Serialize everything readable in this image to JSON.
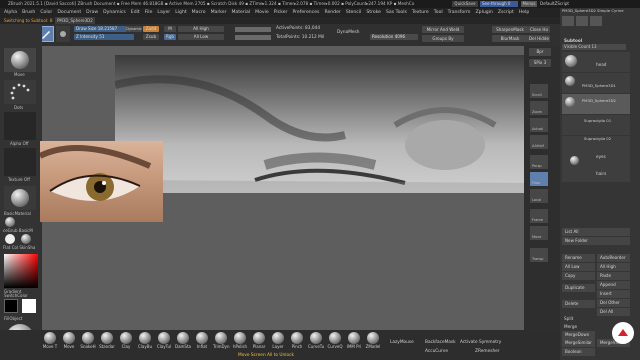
{
  "titlebar": {
    "text": "ZBrush 2021.5.1  [David Saccoti]   ZBrush Document   ▪ Free Mem 46.818GB ▪ Active Mem 2705 ▪ Scratch Disk 49 ▪ ZTime▸1.324 ▪ Timer▸2.078 ▪ Timer▸0.002 ▪ PolyCount▸247.194 KP ▪ MeshCo",
    "quicksave": "QuickSave",
    "seethrough": "See-through  0",
    "menus": "Menus",
    "script": "DefaultZScript"
  },
  "menubar": {
    "items": [
      "Alpha",
      "Brush",
      "Color",
      "Document",
      "Draw",
      "Dynamics",
      "Edit",
      "File",
      "Layer",
      "Light",
      "Macro",
      "Marker",
      "Material",
      "Movie",
      "Picker",
      "Preferences",
      "Render",
      "Stencil",
      "Stroke",
      "Sas Tools",
      "Texture",
      "Tool",
      "Transform",
      "Zplugin",
      "Zscript",
      "Help"
    ]
  },
  "subbar": {
    "text": "Switching to Subtool: 8",
    "tool": "PM3D_Sphere3D2"
  },
  "toolbar": {
    "mirror": "Mirror",
    "multimapper": "MultiMap",
    "draw_size": "Draw Size 18.21587",
    "z_intensity": "Z Intensity 51",
    "dynamic": "Dynamic",
    "zadd": "Zadd",
    "zsub": "Zsub",
    "zcut": "Zcut",
    "mrgb": "Rgb",
    "m": "M",
    "rgb_label": "Rgb",
    "all_high": "All High",
    "all_low": "All Low",
    "active_points": "ActivePoints: 83,044",
    "total_points": "TotalPoints: 10.212 Mil",
    "dynamesh": "DynaMesh",
    "resolution": "Resolution 4096",
    "mirror_weld": "Mirror And Weld",
    "group_by": "Groups By",
    "sharpen_mask": "SharpenMask",
    "blur_mask": "BlurMask",
    "close_holes": "Close Ho",
    "del_hidden": "Del Hidde"
  },
  "leftpanel": {
    "move": "Move",
    "dots": "Dots",
    "alpha_off": "Alpha Off",
    "texture_off": "Texture Off",
    "basic_material": "BasicMaterial",
    "zbrush_basic": "ceGrub BasicM",
    "flat_color": "Flat Col SkinSha",
    "gradient": "Gradient",
    "switch_color": "SwitchColor",
    "fill_object": "FillObject"
  },
  "rightstrip": {
    "items": [
      "Bpr",
      "SPix 3",
      "Scroll",
      "Zoom",
      "Actual",
      "AAHalf",
      "Persp",
      "Floor",
      "Local",
      "Frame",
      "Move",
      "Transp"
    ]
  },
  "rightpanel": {
    "header": "PM3D_Sphere3D2  Simple Cyrine",
    "subtool": "Subtool",
    "visible_count": "Visible Count 13",
    "subtools": [
      "head",
      "PM3D_Sphere3D1",
      "PM3D_Sphere3D2",
      "Supraciglio 01",
      "Supraciglio 02",
      "eyes",
      "hairs"
    ],
    "list_all": "List All",
    "new_folder": "New Folder",
    "rename": "Rename",
    "auto_reorder": "AutoReorder",
    "all_low": "All Low",
    "all_high": "All High",
    "copy": "Copy",
    "paste": "Paste",
    "append": "Append",
    "duplicate": "Duplicate",
    "insert": "Insert",
    "delete": "Delete",
    "del_other": "Del Other",
    "del_all": "Del All",
    "split": "Split",
    "merge": "Merge",
    "merge_down": "MergeDown",
    "merge_similar": "MergeSimilar",
    "merge_visible": "MergeVisible",
    "boolean": "Boolean"
  },
  "bottombar": {
    "brushes": [
      "Move T",
      "Move",
      "SnakeH",
      "Standar",
      "Clay",
      "ClayBu",
      "ClayTul",
      "DamSta",
      "Inflat",
      "TrimDyn",
      "hPolish",
      "Planar",
      "Layer",
      "Pinch",
      "CurveTu",
      "CurveQ",
      "IMM Pri",
      "ZModel"
    ],
    "lazy_mouse": "LazyMouse",
    "backface_mask": "BackfaceMask",
    "activate_symmetry": "Activate Symmetry",
    "accu_curve": "AccuCurve",
    "zremesher": "ZRemesher",
    "status": "Move Screen All to Unlock"
  }
}
